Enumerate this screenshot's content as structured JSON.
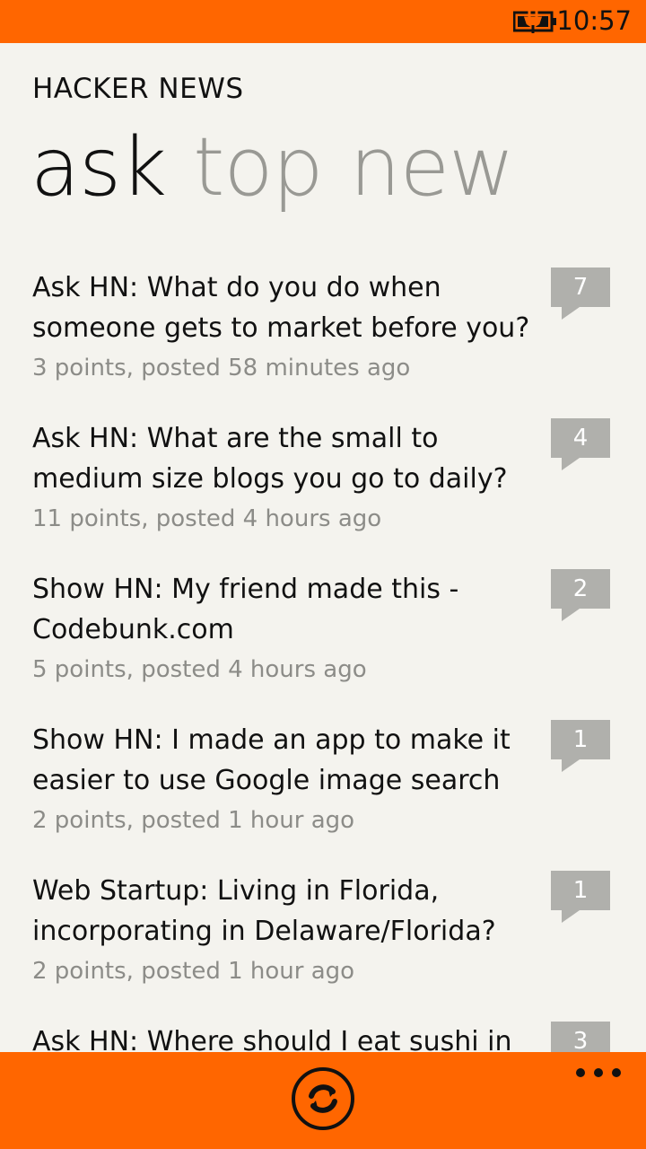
{
  "status_bar": {
    "time": "10:57",
    "battery_icon": "battery-charging-icon"
  },
  "app": {
    "title": "HACKER NEWS"
  },
  "pivot": {
    "items": [
      {
        "label": "ask",
        "active": true
      },
      {
        "label": "top",
        "active": false
      },
      {
        "label": "new",
        "active": false
      }
    ]
  },
  "stories": [
    {
      "title": "Ask HN: What do you do when someone gets to market before you?",
      "meta": "3 points, posted 58 minutes ago",
      "comments": "7"
    },
    {
      "title": "Ask HN: What are the small to medium size blogs you go to daily?",
      "meta": "11 points, posted 4 hours ago",
      "comments": "4"
    },
    {
      "title": "Show HN: My friend made this - Codebunk.com",
      "meta": "5 points, posted 4 hours ago",
      "comments": "2"
    },
    {
      "title": "Show HN: I made an app to make it easier to use Google image search",
      "meta": "2 points, posted 1 hour ago",
      "comments": "1"
    },
    {
      "title": "Web Startup: Living in Florida, incorporating in Delaware/Florida?",
      "meta": "2 points, posted 1 hour ago",
      "comments": "1"
    },
    {
      "title": "Ask HN: Where should I eat sushi in",
      "meta": "",
      "comments": "3"
    }
  ],
  "app_bar": {
    "refresh_icon": "refresh-icon",
    "more_icon": "more-icon"
  },
  "colors": {
    "accent": "#ff6600",
    "background": "#f4f3ee",
    "comment_bubble": "#b0b0ac"
  }
}
